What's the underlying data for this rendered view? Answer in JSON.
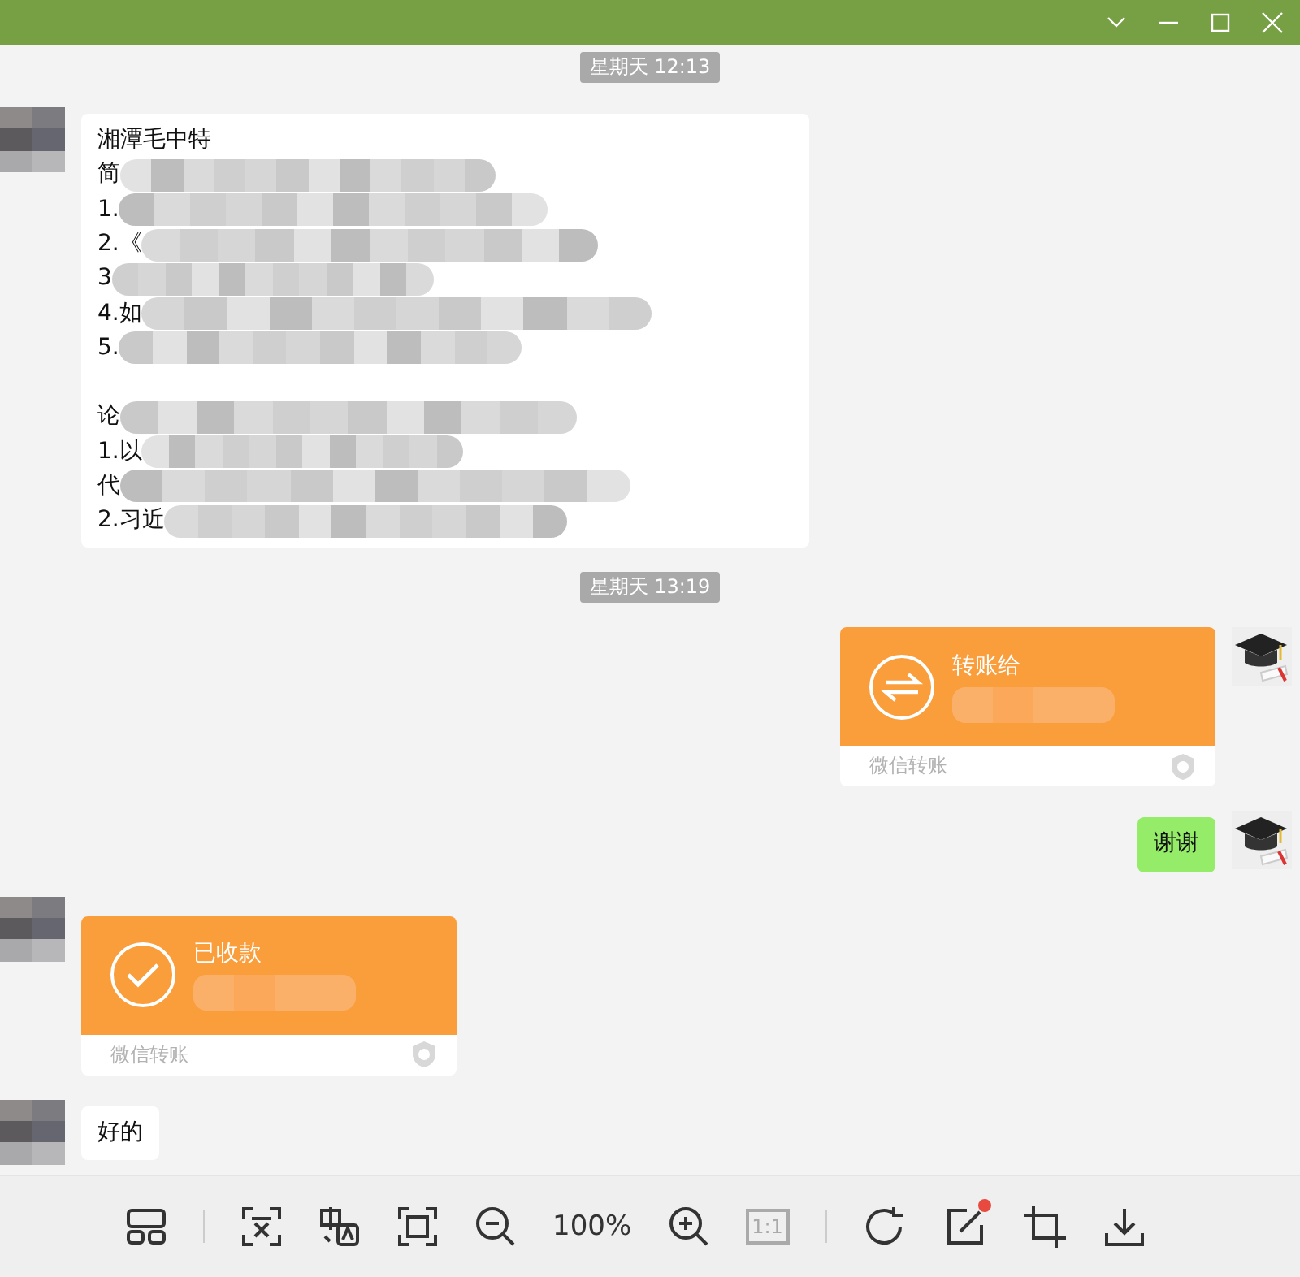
{
  "messages": [
    {
      "kind": "timestamp",
      "text": "星期天 12:13"
    },
    {
      "kind": "text-left",
      "paragraphs": [
        {
          "lines": [
            {
              "text": "湘潭毛中特",
              "redacted": false
            },
            {
              "text": "简",
              "redacted": true
            },
            {
              "text": "1.",
              "redacted": true
            },
            {
              "text": "2.《",
              "redacted": true
            },
            {
              "text": "3",
              "redacted": true
            },
            {
              "text": "4.如",
              "redacted": true
            },
            {
              "text": "5.",
              "redacted": true
            }
          ]
        },
        {
          "lines": [
            {
              "text": "论",
              "redacted": true
            },
            {
              "text": "1.以",
              "redacted": true
            },
            {
              "text": "代",
              "redacted": true
            },
            {
              "text": "2.习近",
              "redacted": true
            }
          ]
        }
      ]
    },
    {
      "kind": "timestamp",
      "text": "星期天 13:19"
    },
    {
      "kind": "transfer-sent",
      "title": "转账给",
      "footer": "微信转账"
    },
    {
      "kind": "text-right",
      "paragraphs": [
        {
          "lines": [
            {
              "text": "谢谢",
              "redacted": false
            }
          ]
        }
      ]
    },
    {
      "kind": "transfer-received",
      "title": "已收款",
      "footer": "微信转账"
    },
    {
      "kind": "text-left",
      "paragraphs": [
        {
          "lines": [
            {
              "text": "好的",
              "redacted": false
            }
          ]
        }
      ]
    }
  ],
  "toolbar": [
    {
      "kind": "layout"
    },
    {
      "kind": "separator"
    },
    {
      "kind": "scan"
    },
    {
      "kind": "translate"
    },
    {
      "kind": "fit"
    },
    {
      "kind": "zoom-out"
    },
    {
      "kind": "label",
      "text": "100%"
    },
    {
      "kind": "zoom-in"
    },
    {
      "kind": "ratio",
      "text": "1:1",
      "disabled": true
    },
    {
      "kind": "separator"
    },
    {
      "kind": "rotate"
    },
    {
      "kind": "edit",
      "badge": true
    },
    {
      "kind": "crop"
    },
    {
      "kind": "download"
    }
  ]
}
